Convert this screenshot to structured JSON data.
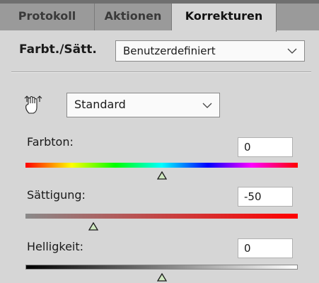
{
  "tabs": [
    {
      "label": "Protokoll",
      "active": false
    },
    {
      "label": "Aktionen",
      "active": false
    },
    {
      "label": "Korrekturen",
      "active": true
    }
  ],
  "preset": {
    "label": "Farbt./Sätt.",
    "selected": "Benutzerdefiniert"
  },
  "tool": {
    "icon": "hand-adjust-icon",
    "channel_selected": "Standard"
  },
  "sliders": {
    "hue": {
      "label": "Farbton:",
      "value": "0",
      "fraction": 0.5
    },
    "saturation": {
      "label": "Sättigung:",
      "value": "-50",
      "fraction": 0.25
    },
    "lightness": {
      "label": "Helligkeit:",
      "value": "0",
      "fraction": 0.5
    }
  },
  "colors": {
    "panel": "#d6d6d6",
    "tab_inactive": "#9a9a9a",
    "tab_bar": "#6f6f6f",
    "thumb_fill": "#cfe8c0",
    "thumb_stroke": "#1a1a1a"
  }
}
